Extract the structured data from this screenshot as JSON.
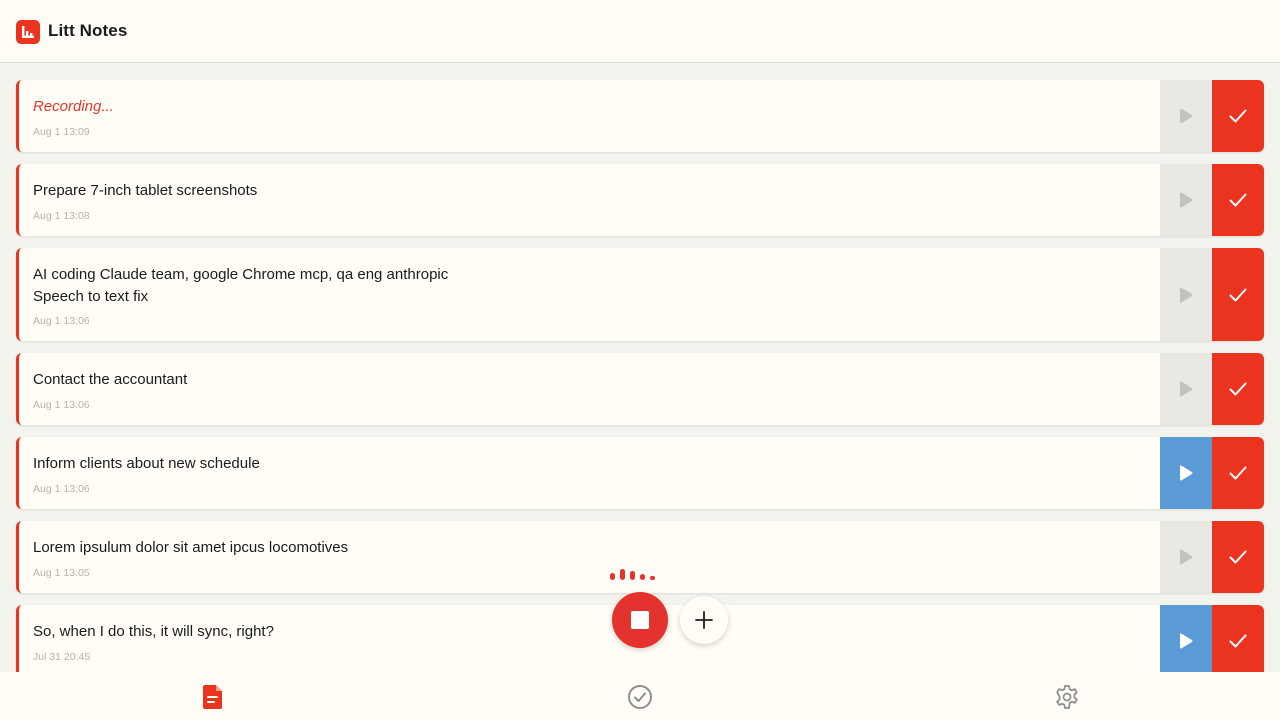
{
  "app": {
    "title": "Litt Notes",
    "logo_icon": "bar-chart-icon",
    "accent": "#ea3420"
  },
  "notes": [
    {
      "text": "Recording...",
      "time": "Aug 1 13:09",
      "recording": true,
      "play_active": false
    },
    {
      "text": "Prepare 7-inch tablet screenshots",
      "time": "Aug 1 13:08",
      "recording": false,
      "play_active": false
    },
    {
      "text": "AI coding Claude team, google Chrome mcp, qa eng anthropic\nSpeech to text fix",
      "time": "Aug 1 13:06",
      "recording": false,
      "play_active": false
    },
    {
      "text": "Contact the accountant",
      "time": "Aug 1 13:06",
      "recording": false,
      "play_active": false
    },
    {
      "text": "Inform clients about new schedule",
      "time": "Aug 1 13:06",
      "recording": false,
      "play_active": true
    },
    {
      "text": "Lorem ipsulum dolor sit amet ipcus locomotives",
      "time": "Aug 1 13:05",
      "recording": false,
      "play_active": false
    },
    {
      "text": "So, when I do this, it will sync, right?",
      "time": "Jul 31 20:45",
      "recording": false,
      "play_active": true
    }
  ],
  "controls": {
    "stop_icon": "stop-icon",
    "add_icon": "plus-icon",
    "wave_icon": "audio-level-icon"
  },
  "nav": [
    {
      "name": "nav-notes",
      "icon": "document-icon",
      "active": true
    },
    {
      "name": "nav-done",
      "icon": "check-circle-icon",
      "active": false
    },
    {
      "name": "nav-settings",
      "icon": "gear-icon",
      "active": false
    }
  ],
  "colors": {
    "play_active": "#5b9bd5",
    "play_inactive": "#eae8e3",
    "done": "#ea3420"
  }
}
